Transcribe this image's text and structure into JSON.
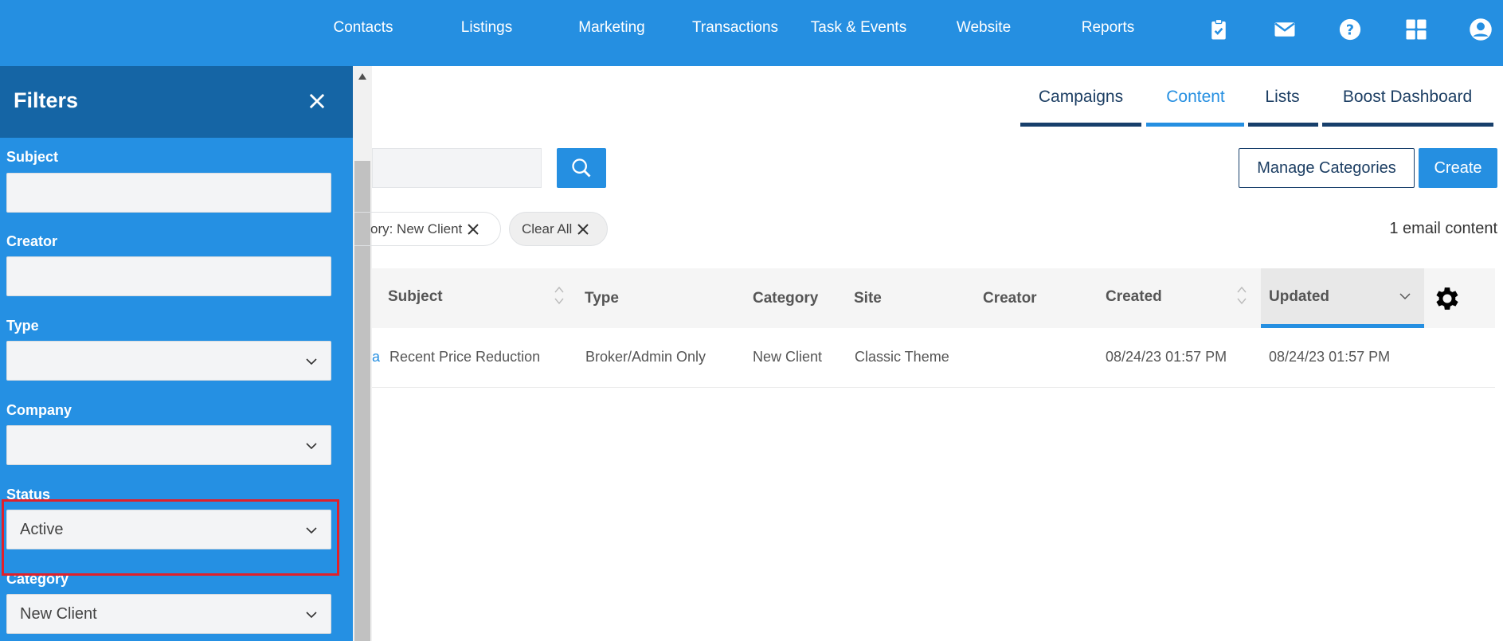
{
  "colors": {
    "primary": "#258fe1",
    "sidebar_header": "#1565a5",
    "navy": "#173f6b",
    "highlight": "#e0202a"
  },
  "topnav": {
    "items": [
      "Contacts",
      "Listings",
      "Marketing",
      "Transactions",
      "Task & Events",
      "Website",
      "Reports"
    ],
    "icons": [
      "clipboard-check-icon",
      "mail-icon",
      "help-icon",
      "apps-grid-icon",
      "user-account-icon"
    ]
  },
  "filters": {
    "title": "Filters",
    "fields": [
      {
        "label": "Subject",
        "value": "",
        "kind": "text"
      },
      {
        "label": "Creator",
        "value": "",
        "kind": "text"
      },
      {
        "label": "Type",
        "value": "",
        "kind": "select"
      },
      {
        "label": "Company",
        "value": "",
        "kind": "select"
      },
      {
        "label": "Status",
        "value": "Active",
        "kind": "select"
      },
      {
        "label": "Category",
        "value": "New Client",
        "kind": "select"
      }
    ]
  },
  "tabs": [
    {
      "label": "Campaigns",
      "active": false
    },
    {
      "label": "Content",
      "active": true
    },
    {
      "label": "Lists",
      "active": false
    },
    {
      "label": "Boost Dashboard",
      "active": false
    }
  ],
  "toolbar": {
    "search_value": "",
    "manage_label": "Manage Categories",
    "create_label": "Create"
  },
  "chips": {
    "category": "ory: New Client",
    "clear": "Clear All"
  },
  "result_count": "1 email content",
  "table": {
    "columns": [
      "Subject",
      "Type",
      "Category",
      "Site",
      "Creator",
      "Created",
      "Updated"
    ],
    "sorted_column": "Updated",
    "rows": [
      {
        "lead": "a",
        "subject": "Recent Price Reduction",
        "type": "Broker/Admin Only",
        "category": "New Client",
        "site": "Classic Theme",
        "creator": "",
        "created": "08/24/23 01:57 PM",
        "updated": "08/24/23 01:57 PM"
      }
    ]
  }
}
